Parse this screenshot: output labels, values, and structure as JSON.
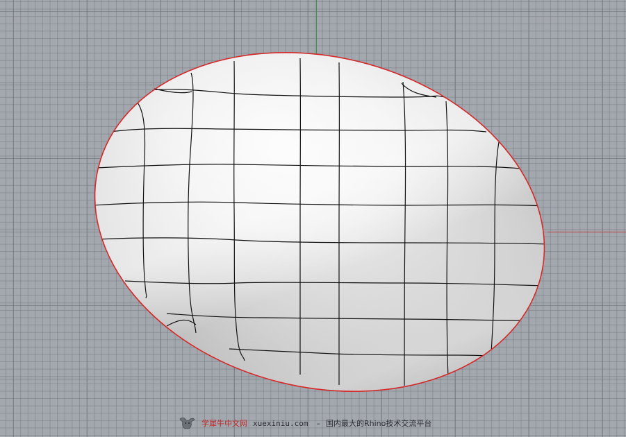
{
  "viewport": {
    "background_color": "#a3a8ae",
    "grid_minor_color": "#767c83",
    "grid_major_color": "#686e75",
    "x_axis_color": "#c23a3a",
    "y_axis_color": "#2f9a3c"
  },
  "surface": {
    "object_type": "nurbs-surface",
    "selected": true,
    "selection_outline_color": "#d42a2a",
    "isocurve_color": "#111111",
    "shading_highlight": "#fbfbfb",
    "shading_shadow": "#a7a7a7"
  },
  "watermark": {
    "logo_icon": "bull-logo-icon",
    "brand": "学犀牛中文网",
    "site": "xuexiniu.com",
    "separator": "–",
    "tagline": "国内最大的Rhino技术交流平台"
  }
}
